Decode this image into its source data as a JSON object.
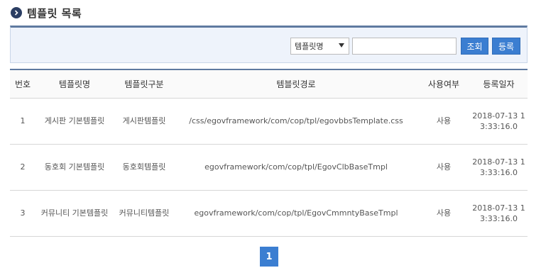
{
  "header": {
    "title": "템플릿 목록",
    "icon": "chevron-right-circle-icon"
  },
  "search": {
    "select_value": "템플릿명",
    "input_value": "",
    "search_button": "조회",
    "register_button": "등록"
  },
  "table": {
    "columns": [
      "번호",
      "템플릿명",
      "템플릿구분",
      "템블릿경로",
      "사용여부",
      "등록일자"
    ],
    "rows": [
      {
        "no": "1",
        "name": "게시판 기본템플릿",
        "type": "게시판템플릿",
        "path": "/css/egovframework/com/cop/tpl/egovbbsTemplate.css",
        "use": "사용",
        "date": "2018-07-13 13:33:16.0"
      },
      {
        "no": "2",
        "name": "동호회 기본템플릿",
        "type": "동호회템플릿",
        "path": "egovframework/com/cop/tpl/EgovClbBaseTmpl",
        "use": "사용",
        "date": "2018-07-13 13:33:16.0"
      },
      {
        "no": "3",
        "name": "커뮤니티 기본템플릿",
        "type": "커뮤니티템플릿",
        "path": "egovframework/com/cop/tpl/EgovCmmntyBaseTmpl",
        "use": "사용",
        "date": "2018-07-13 13:33:16.0"
      }
    ]
  },
  "pagination": {
    "current": "1"
  },
  "colors": {
    "accent": "#3b7ed1",
    "header_border": "#5f7aa0",
    "search_bg": "#eef3fb"
  }
}
